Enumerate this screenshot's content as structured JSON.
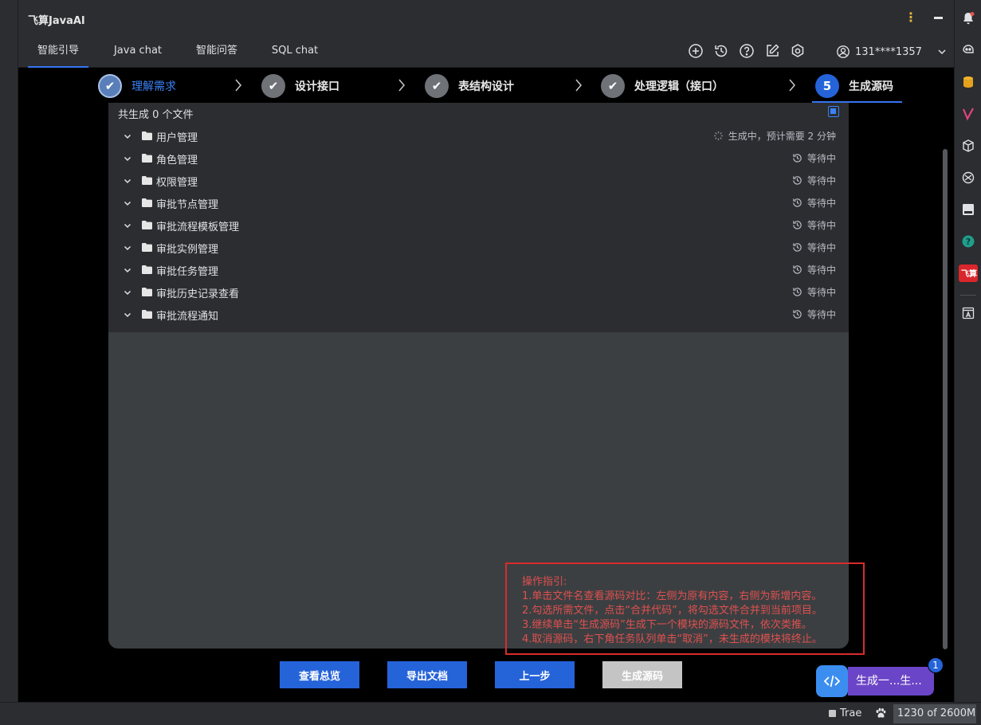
{
  "app": {
    "title": "飞算JavaAI"
  },
  "tabs": [
    {
      "label": "智能引导",
      "active": true
    },
    {
      "label": "Java chat",
      "active": false
    },
    {
      "label": "智能问答",
      "active": false
    },
    {
      "label": "SQL chat",
      "active": false
    }
  ],
  "toolbar_icons": [
    "plus-circle-icon",
    "history-icon",
    "help-icon",
    "edit-icon",
    "settings-icon"
  ],
  "user": {
    "phone": "131****1357"
  },
  "steps": [
    {
      "label": "理解需求",
      "state": "done"
    },
    {
      "label": "设计接口",
      "state": "done"
    },
    {
      "label": "表结构设计",
      "state": "done"
    },
    {
      "label": "处理逻辑（接口）",
      "state": "done"
    },
    {
      "label": "生成源码",
      "state": "current",
      "number": "5"
    }
  ],
  "files": {
    "summary": "共生成 0 个文件",
    "modules": [
      {
        "name": "用户管理",
        "status": "生成中，预计需要 2 分钟",
        "icon": "loading-icon"
      },
      {
        "name": "角色管理",
        "status": "等待中",
        "icon": "history-icon"
      },
      {
        "name": "权限管理",
        "status": "等待中",
        "icon": "history-icon"
      },
      {
        "name": "审批节点管理",
        "status": "等待中",
        "icon": "history-icon"
      },
      {
        "name": "审批流程模板管理",
        "status": "等待中",
        "icon": "history-icon"
      },
      {
        "name": "审批实例管理",
        "status": "等待中",
        "icon": "history-icon"
      },
      {
        "name": "审批任务管理",
        "status": "等待中",
        "icon": "history-icon"
      },
      {
        "name": "审批历史记录查看",
        "status": "等待中",
        "icon": "history-icon"
      },
      {
        "name": "审批流程通知",
        "status": "等待中",
        "icon": "history-icon"
      }
    ]
  },
  "guide": {
    "title": "操作指引:",
    "lines": [
      "1.单击文件名查看源码对比：左侧为原有内容，右侧为新增内容。",
      "2.勾选所需文件，点击“合并代码”，将勾选文件合并到当前项目。",
      "3.继续单击“生成源码”生成下一个模块的源码文件，依次类推。",
      "4.取消源码，右下角任务队列单击“取消”，未生成的模块将终止。"
    ]
  },
  "buttons": {
    "overview": "查看总览",
    "export": "导出文档",
    "prev": "上一步",
    "generate": "生成源码"
  },
  "task_queue": {
    "label": "生成一...生...",
    "badge": "1"
  },
  "right_strip_icons": [
    "notifications-icon",
    "ai-assistant-icon",
    "database-icon",
    "maven-icon",
    "packages-icon",
    "services-icon",
    "terminal-icon",
    "help-circle-icon",
    "feisuan-icon",
    "translate-icon"
  ],
  "feisuan_label": "飞算",
  "statusbar": {
    "trae": "Trae",
    "memory": "1230 of 2600M"
  },
  "colors": {
    "accent": "#3574f0",
    "primary_button": "#2563d9",
    "guide_red": "#e05050",
    "task_purple": "#6b45c7"
  }
}
